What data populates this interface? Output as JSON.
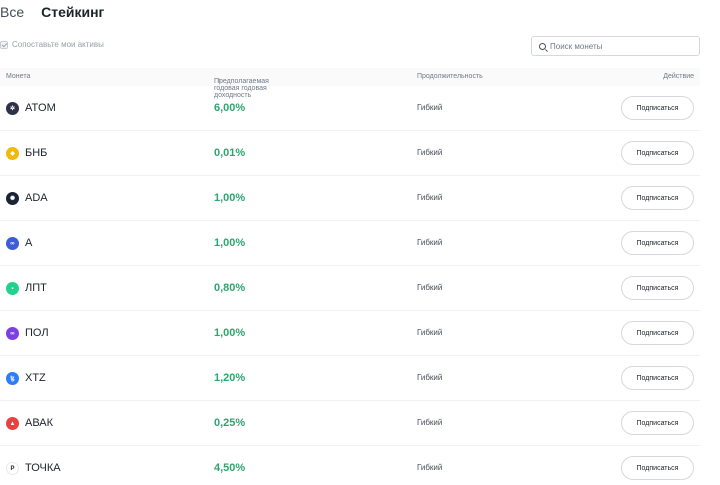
{
  "tabs": {
    "all": "Все",
    "staking": "Стейкинг"
  },
  "compare": {
    "label": "Сопоставьте мои активы",
    "checked": true
  },
  "search": {
    "placeholder": "Поиск монеты",
    "value": ""
  },
  "table": {
    "headers": {
      "coin": "Монета",
      "yield": "Предполагаемая годовая годовая доходность",
      "duration": "Продолжительность",
      "action": "Действие"
    },
    "rows": [
      {
        "coin": "ATOM",
        "yield": "6,00%",
        "duration": "Гибкий",
        "action": "Подписаться",
        "icon": "cosmos-icon",
        "icon_color": "#2e3148",
        "icon_glyph": "✲"
      },
      {
        "coin": "БНБ",
        "yield": "0,01%",
        "duration": "Гибкий",
        "action": "Подписаться",
        "icon": "bnb-icon",
        "icon_color": "#f0b90b",
        "icon_glyph": "◆"
      },
      {
        "coin": "ADA",
        "yield": "1,00%",
        "duration": "Гибкий",
        "action": "Подписаться",
        "icon": "cardano-icon",
        "icon_color": "#1b2435",
        "icon_glyph": "✺"
      },
      {
        "coin": "A",
        "yield": "1,00%",
        "duration": "Гибкий",
        "action": "Подписаться",
        "icon": "a-token-icon",
        "icon_color": "#3c5cd8",
        "icon_glyph": "∞"
      },
      {
        "coin": "ЛПТ",
        "yield": "0,80%",
        "duration": "Гибкий",
        "action": "Подписаться",
        "icon": "livepeer-icon",
        "icon_color": "#22d18b",
        "icon_glyph": "▪"
      },
      {
        "coin": "ПОЛ",
        "yield": "1,00%",
        "duration": "Гибкий",
        "action": "Подписаться",
        "icon": "polygon-icon",
        "icon_color": "#7b3fe4",
        "icon_glyph": "∞"
      },
      {
        "coin": "XTZ",
        "yield": "1,20%",
        "duration": "Гибкий",
        "action": "Подписаться",
        "icon": "tezos-icon",
        "icon_color": "#2c7df7",
        "icon_glyph": "ꜩ"
      },
      {
        "coin": "АВАК",
        "yield": "0,25%",
        "duration": "Гибкий",
        "action": "Подписаться",
        "icon": "avalanche-icon",
        "icon_color": "#e84142",
        "icon_glyph": "▲"
      },
      {
        "coin": "ТОЧКА",
        "yield": "4,50%",
        "duration": "Гибкий",
        "action": "Подписаться",
        "icon": "polkadot-icon",
        "icon_color": "#ffffff",
        "icon_glyph": "P"
      }
    ]
  }
}
